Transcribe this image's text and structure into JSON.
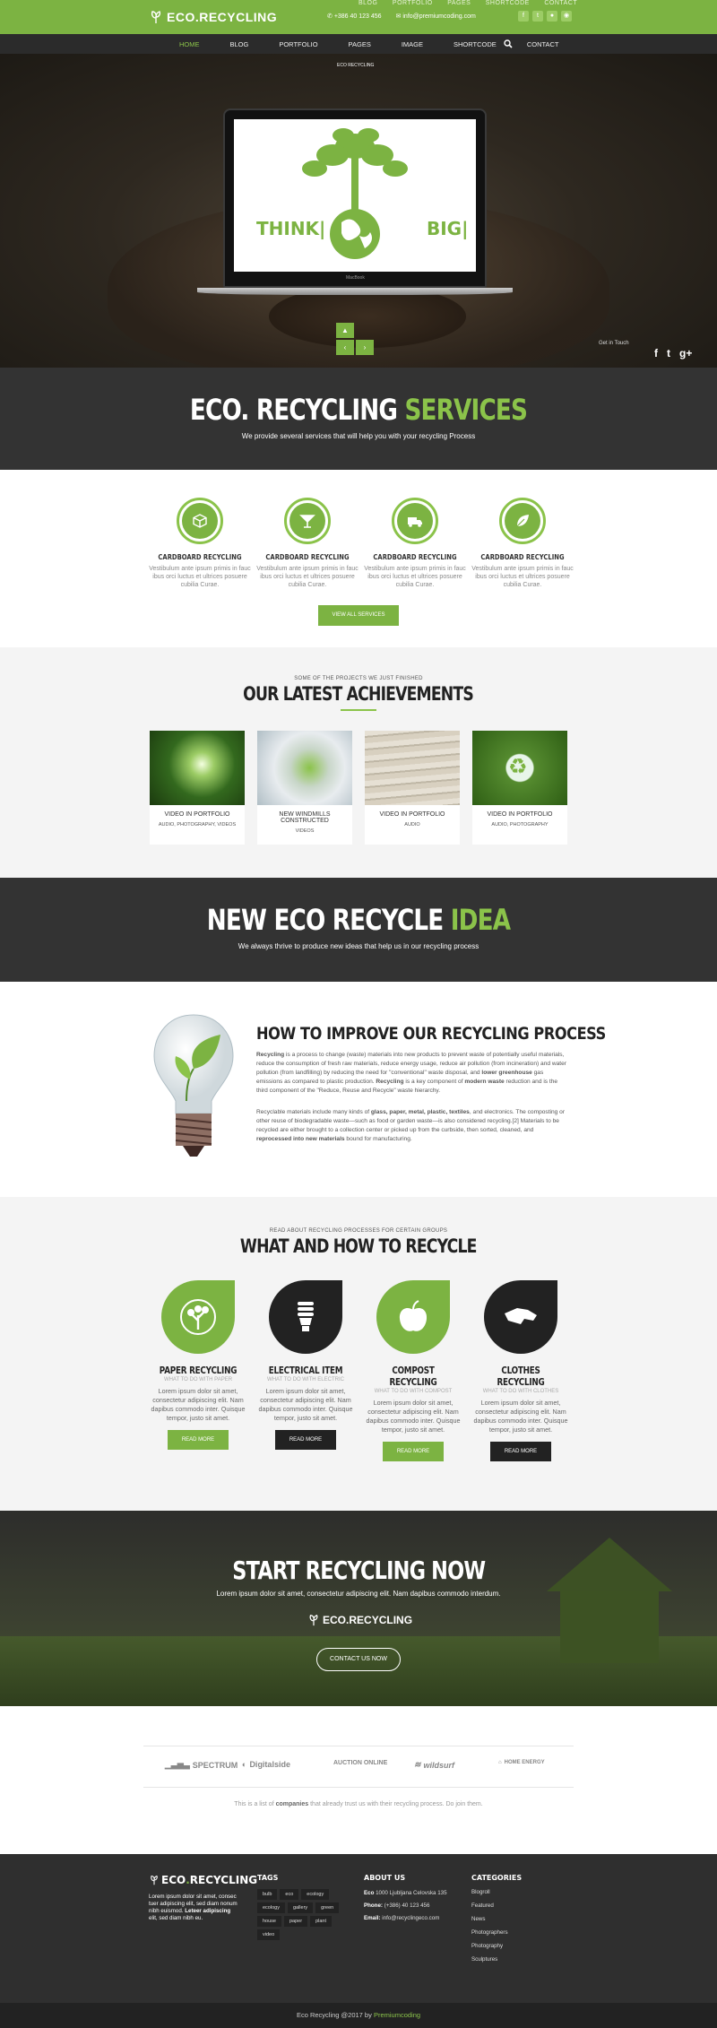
{
  "brand": {
    "logo_main": "ECO",
    "logo_dot": ".",
    "logo_rest": "RECYCLING",
    "accent": "#7cb342",
    "dark": "#333333"
  },
  "topbar": {
    "faded_menu": [
      "BLOG",
      "PORTFOLIO",
      "PAGES",
      "SHORTCODE",
      "CONTACT"
    ],
    "phone": "+386 40 123 456",
    "email": "info@premiumcoding.com",
    "social_icons": [
      "facebook-icon",
      "twitter-icon",
      "dribbble-icon",
      "rss-icon"
    ]
  },
  "nav": {
    "items": [
      "HOME",
      "BLOG",
      "PORTFOLIO",
      "PAGES",
      "IMAGE",
      "SHORTCODE",
      "CONTACT"
    ],
    "active": "HOME"
  },
  "hero": {
    "sprout_label": "ECO RECYCLING",
    "screen_left": "THINK|",
    "screen_right": "BIG|",
    "laptop_brand": "MacBook",
    "get_in_touch": "Get in Touch",
    "social": [
      "f",
      "t",
      "g+"
    ]
  },
  "services_banner": {
    "title_white": "ECO. RECYCLING",
    "title_green": "SERVICES",
    "subtitle": "We provide several services that will help you with your recycling Process"
  },
  "services": {
    "items": [
      {
        "title": "CARDBOARD RECYCLING",
        "text": "Vestibulum ante ipsum primis in fauc ibus orci luctus et ultrices posuere cubilia Curae."
      },
      {
        "title": "CARDBOARD RECYCLING",
        "text": "Vestibulum ante ipsum primis in fauc ibus orci luctus et ultrices posuere cubilia Curae."
      },
      {
        "title": "CARDBOARD RECYCLING",
        "text": "Vestibulum ante ipsum primis in fauc ibus orci luctus et ultrices posuere cubilia Curae."
      },
      {
        "title": "CARDBOARD RECYCLING",
        "text": "Vestibulum ante ipsum primis in fauc ibus orci luctus et ultrices posuere cubilia Curae."
      }
    ],
    "button": "VIEW ALL SERVICES"
  },
  "achievements": {
    "kicker": "SOME OF THE PROJECTS WE JUST FINISHED",
    "title": "OUR LATEST ACHIEVEMENTS",
    "cards": [
      {
        "title": "VIDEO IN PORTFOLIO",
        "tags": "AUDIO, PHOTOGRAPHY, VIDEOS"
      },
      {
        "title": "NEW WINDMILLS CONSTRUCTED",
        "tags": "VIDEOS"
      },
      {
        "title": "VIDEO IN PORTFOLIO",
        "tags": "AUDIO"
      },
      {
        "title": "VIDEO IN PORTFOLIO",
        "tags": "AUDIO, PHOTOGRAPHY"
      }
    ]
  },
  "idea_banner": {
    "title_white": "NEW ECO RECYCLE",
    "title_green": "IDEA",
    "subtitle": "We always thrive to produce new ideas that help us in our recycling process"
  },
  "idea": {
    "title": "HOW TO IMPROVE OUR RECYCLING PROCESS",
    "p1_b1": "Recycling",
    "p1_t1": " is a process to change (waste) materials into new products to prevent waste of potentially useful materials, reduce the consumption of fresh raw materials, reduce energy usage, reduce air pollution (from incineration) and water pollution (from landfilling) by reducing the need for \"conventional\" waste disposal, and ",
    "p1_b2": "lower greenhouse",
    "p1_t2": " gas emissions as compared to plastic production. ",
    "p1_b3": "Recycling",
    "p1_t3": " is a key component of ",
    "p1_b4": "modern waste",
    "p1_t4": " reduction and is the third component of the \"Reduce, Reuse and Recycle\" waste hierarchy.",
    "p2_t1": "Recyclable materials include many kinds of ",
    "p2_b1": "glass, paper, metal, plastic, textiles",
    "p2_t2": ", and electronics. The composting or other reuse of biodegradable waste—such as food or garden waste—is also considered recycling.[2] Materials to be recycled are either brought to a collection center or picked up from the curbside, then sorted, cleaned, and ",
    "p2_b2": "reprocessed into new materials",
    "p2_t3": " bound for manufacturing."
  },
  "whathow": {
    "kicker": "READ ABOUT RECYCLING PROCESSES FOR CERTAIN GROUPS",
    "title": "WHAT AND HOW TO RECYCLE",
    "items": [
      {
        "title": "PAPER RECYCLING",
        "sub": "WHAT TO DO WITH PAPER",
        "text": "Lorem ipsum dolor sit amet, consectetur adipiscing elit. Nam dapibus commodo inter. Quisque tempor, justo sit amet.",
        "button": "READ MORE",
        "color": "#7cb342"
      },
      {
        "title": "ELECTRICAL ITEM",
        "sub": "WHAT TO DO WITH ELECTRIC",
        "text": "Lorem ipsum dolor sit amet, consectetur adipiscing elit. Nam dapibus commodo inter. Quisque tempor, justo sit amet.",
        "button": "READ MORE",
        "color": "#222222"
      },
      {
        "title": "COMPOST RECYCLING",
        "sub": "WHAT TO DO WITH COMPOST",
        "text": "Lorem ipsum dolor sit amet, consectetur adipiscing elit. Nam dapibus commodo inter. Quisque tempor, justo sit amet.",
        "button": "READ MORE",
        "color": "#7cb342"
      },
      {
        "title": "CLOTHES RECYCLING",
        "sub": "WHAT TO DO WITH CLOTHES",
        "text": "Lorem ipsum dolor sit amet, consectetur adipiscing elit. Nam dapibus commodo inter. Quisque tempor, justo sit amet.",
        "button": "READ MORE",
        "color": "#222222"
      }
    ]
  },
  "start": {
    "title": "START RECYCLING NOW",
    "lead": "Lorem ipsum dolor sit amet, consectetur adipiscing elit. Nam dapibus commodo interdum.",
    "button": "CONTACT US NOW"
  },
  "partners": {
    "logos": [
      "SPECTRUM",
      "Digitalside",
      "AUCTION ONLINE",
      "wildsurf",
      "HOME ENERGY"
    ],
    "note_t1": "This is a list of ",
    "note_b": "companies",
    "note_t2": " that already trust us with their recycling process. Do join them."
  },
  "footer": {
    "about_t1": "Lorem ipsum dolor sit amet, consec tuer adipiscing elit, sed diam nonum nibh euismod. ",
    "about_b": "Leteer adipiscing",
    "about_t2": " elit, sed diam nibh eu.",
    "tags_title": "TAGS",
    "tags": [
      "bulb",
      "eco",
      "ecology",
      "ecology",
      "gallery",
      "green",
      "house",
      "paper",
      "plant",
      "video"
    ],
    "about_title": "ABOUT US",
    "address_b": "Eco",
    "address": " 1000 Ljubljana Celovska 135",
    "phone_b": "Phone:",
    "phone": " (+386) 40 123 456",
    "email_b": "Email:",
    "email": " info@recyclingeco.com",
    "cat_title": "CATEGORIES",
    "categories": [
      "Blogroll",
      "Featured",
      "News",
      "Photographers",
      "Photography",
      "Sculptures"
    ]
  },
  "bottom": {
    "text": "Eco Recycling @2017 by ",
    "author": "Premiumcoding"
  }
}
